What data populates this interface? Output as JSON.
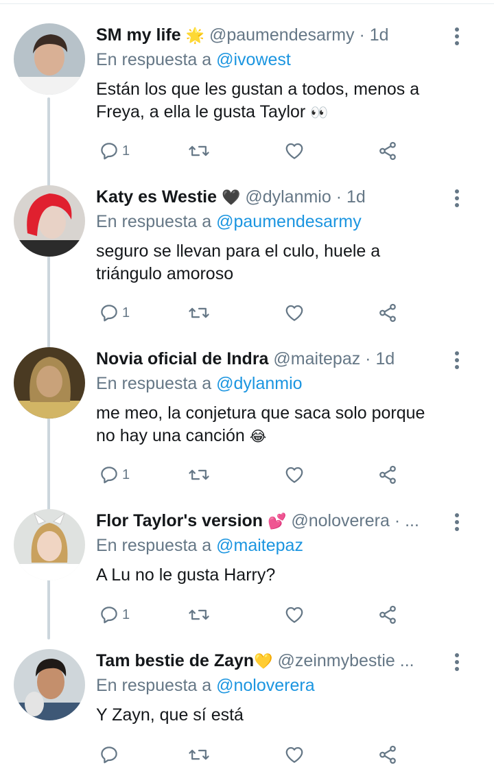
{
  "reply_prefix": "En respuesta a",
  "tweets": [
    {
      "name": "SM my life",
      "name_emoji": "🌟",
      "handle_meta": "@paumendesarmy · 1d",
      "reply_to": "@ivowest",
      "text": "Están los que les gustan a todos, menos a Freya, a ella le gusta Taylor",
      "text_emoji": "👀",
      "reply_count": "1",
      "avatar_colors": {
        "bg": "#b7c2c9",
        "hair": "#3b2c24",
        "skin": "#d9b095",
        "shirt": "#f2f2f2"
      }
    },
    {
      "name": "Katy es Westie",
      "name_emoji": "🖤",
      "handle_meta": "@dylanmio · 1d",
      "reply_to": "@paumendesarmy",
      "text": "seguro se llevan para el culo, huele a triángulo amoroso",
      "text_emoji": "",
      "reply_count": "1",
      "avatar_colors": {
        "bg": "#d8d4d0",
        "hair": "#e0202f",
        "skin": "#e8d2c6",
        "shirt": "#2b2b2b"
      }
    },
    {
      "name": "Novia oficial de Indra",
      "name_emoji": "",
      "handle_meta": "@maitepaz · 1d",
      "reply_to": "@dylanmio",
      "text": "me meo, la conjetura que saca solo porque no hay una canción",
      "text_emoji": "😂",
      "reply_count": "1",
      "avatar_colors": {
        "bg": "#4a3a22",
        "hair": "#a98a52",
        "skin": "#c9a27a",
        "shirt": "#d2b565"
      }
    },
    {
      "name": "Flor Taylor's version",
      "name_emoji": "💕",
      "handle_meta": "@noloverera · ...",
      "reply_to": "@maitepaz",
      "text": "A Lu no le gusta Harry?",
      "text_emoji": "",
      "reply_count": "1",
      "avatar_colors": {
        "bg": "#dfe2e0",
        "hair": "#c9a15e",
        "skin": "#f0d5c3",
        "shirt": "#ffffff"
      }
    },
    {
      "name": "Tam bestie de Zayn",
      "name_emoji": "💛",
      "handle_meta": "@zeinmybestie ...",
      "reply_to": "@noloverera",
      "text": "Y Zayn, que sí está",
      "text_emoji": "",
      "reply_count": "",
      "avatar_colors": {
        "bg": "#cfd6da",
        "hair": "#1f1a17",
        "skin": "#c48f6c",
        "shirt": "#3e5876"
      }
    }
  ]
}
